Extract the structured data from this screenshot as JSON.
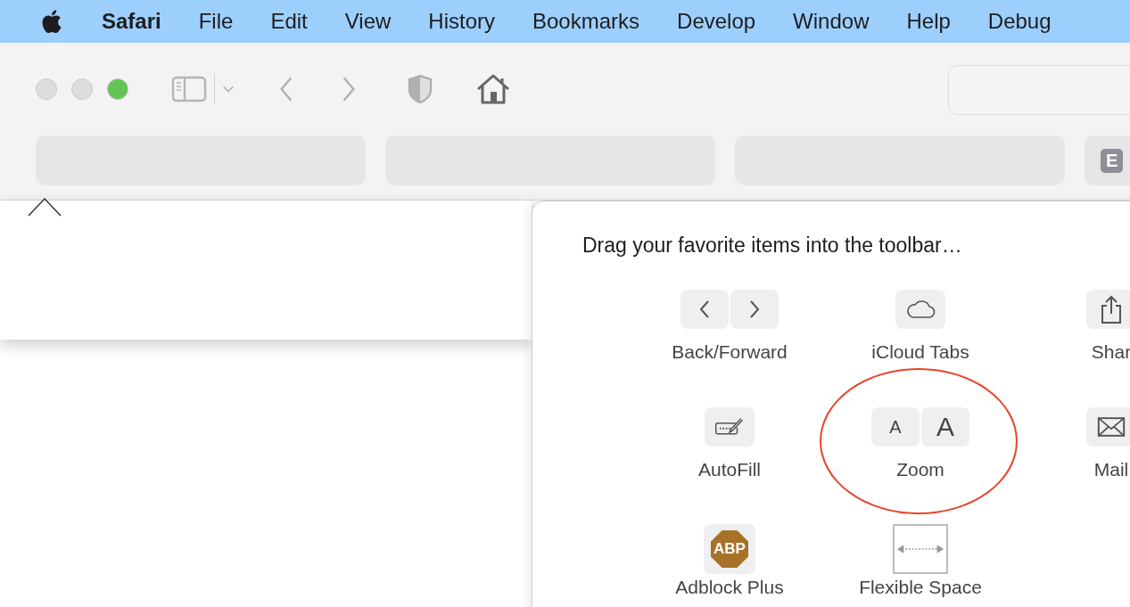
{
  "menu_bar": {
    "app": "Safari",
    "items": [
      "File",
      "Edit",
      "View",
      "History",
      "Bookmarks",
      "Develop",
      "Window",
      "Help",
      "Debug"
    ]
  },
  "window_controls": [
    {
      "color": "#dcdddc"
    },
    {
      "color": "#dcdddc"
    },
    {
      "color": "#62c554"
    }
  ],
  "tab_bar": {
    "last_tab_badge": "E"
  },
  "customize_sheet": {
    "title": "Drag your favorite items into the toolbar…",
    "items": [
      {
        "kind": "back-forward",
        "label": "Back/Forward",
        "circled": false
      },
      {
        "kind": "icloud",
        "label": "iCloud Tabs",
        "circled": false
      },
      {
        "kind": "share",
        "label": "Shar",
        "circled": false
      },
      {
        "kind": "autofill",
        "label": "AutoFill",
        "circled": false
      },
      {
        "kind": "zoom",
        "label": "Zoom",
        "glyphs": [
          "A",
          "A"
        ],
        "circled": true
      },
      {
        "kind": "mail",
        "label": "Mail",
        "circled": false
      },
      {
        "kind": "adblock",
        "label": "Adblock Plus",
        "badge": "ABP",
        "circled": false
      },
      {
        "kind": "flexible-space",
        "label": "Flexible Space",
        "circled": false
      }
    ]
  }
}
